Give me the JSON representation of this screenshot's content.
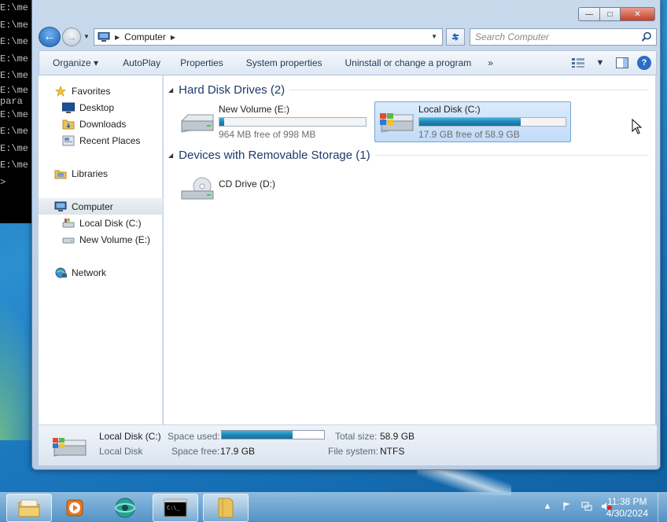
{
  "console": {
    "lines": [
      "E:\\me",
      "E:\\me",
      "E:\\me",
      "E:\\me",
      "E:\\me",
      "E:\\me",
      "E:\\me",
      " para",
      "E:\\me",
      "E:\\me",
      "E:\\me",
      "E:\\me",
      ">"
    ]
  },
  "window": {
    "caption": {
      "minimize": "—",
      "maximize": "□",
      "close": "✕"
    }
  },
  "navbar": {
    "back": "←",
    "forward": "→",
    "breadcrumb": "Computer",
    "search_placeholder": "Search Computer"
  },
  "toolbar": {
    "items": [
      "Organize ▾",
      "AutoPlay",
      "Properties",
      "System properties",
      "Uninstall or change a program"
    ],
    "more": "»"
  },
  "nav_pane": {
    "favorites": "Favorites",
    "desktop": "Desktop",
    "downloads": "Downloads",
    "recent_places": "Recent Places",
    "libraries": "Libraries",
    "computer": "Computer",
    "local_disk": "Local Disk (C:)",
    "new_volume": "New Volume (E:)",
    "network": "Network"
  },
  "main": {
    "hard_disks_header": "Hard Disk Drives (2)",
    "removable_header": "Devices with Removable Storage (1)",
    "drives": [
      {
        "name": "New Volume (E:)",
        "free_text": "964 MB free of 998 MB",
        "used_fraction": 0.034
      },
      {
        "name": "Local Disk (C:)",
        "free_text": "17.9 GB free of 58.9 GB",
        "used_fraction": 0.696
      }
    ],
    "cd_drive": "CD Drive (D:)"
  },
  "details": {
    "name": "Local Disk (C:)",
    "type": "Local Disk",
    "space_used_label": "Space used:",
    "space_used_fraction": 0.696,
    "space_free_label": "Space free:",
    "space_free_value": "17.9 GB",
    "total_size_label": "Total size:",
    "total_size_value": "58.9 GB",
    "file_system_label": "File system:",
    "file_system_value": "NTFS"
  },
  "taskbar": {
    "time": "11:38 PM",
    "date": "4/30/2024"
  },
  "colors": {
    "accent": "#1f84b7",
    "selection": "#c1dcf7",
    "header_text": "#1e3a6a"
  }
}
